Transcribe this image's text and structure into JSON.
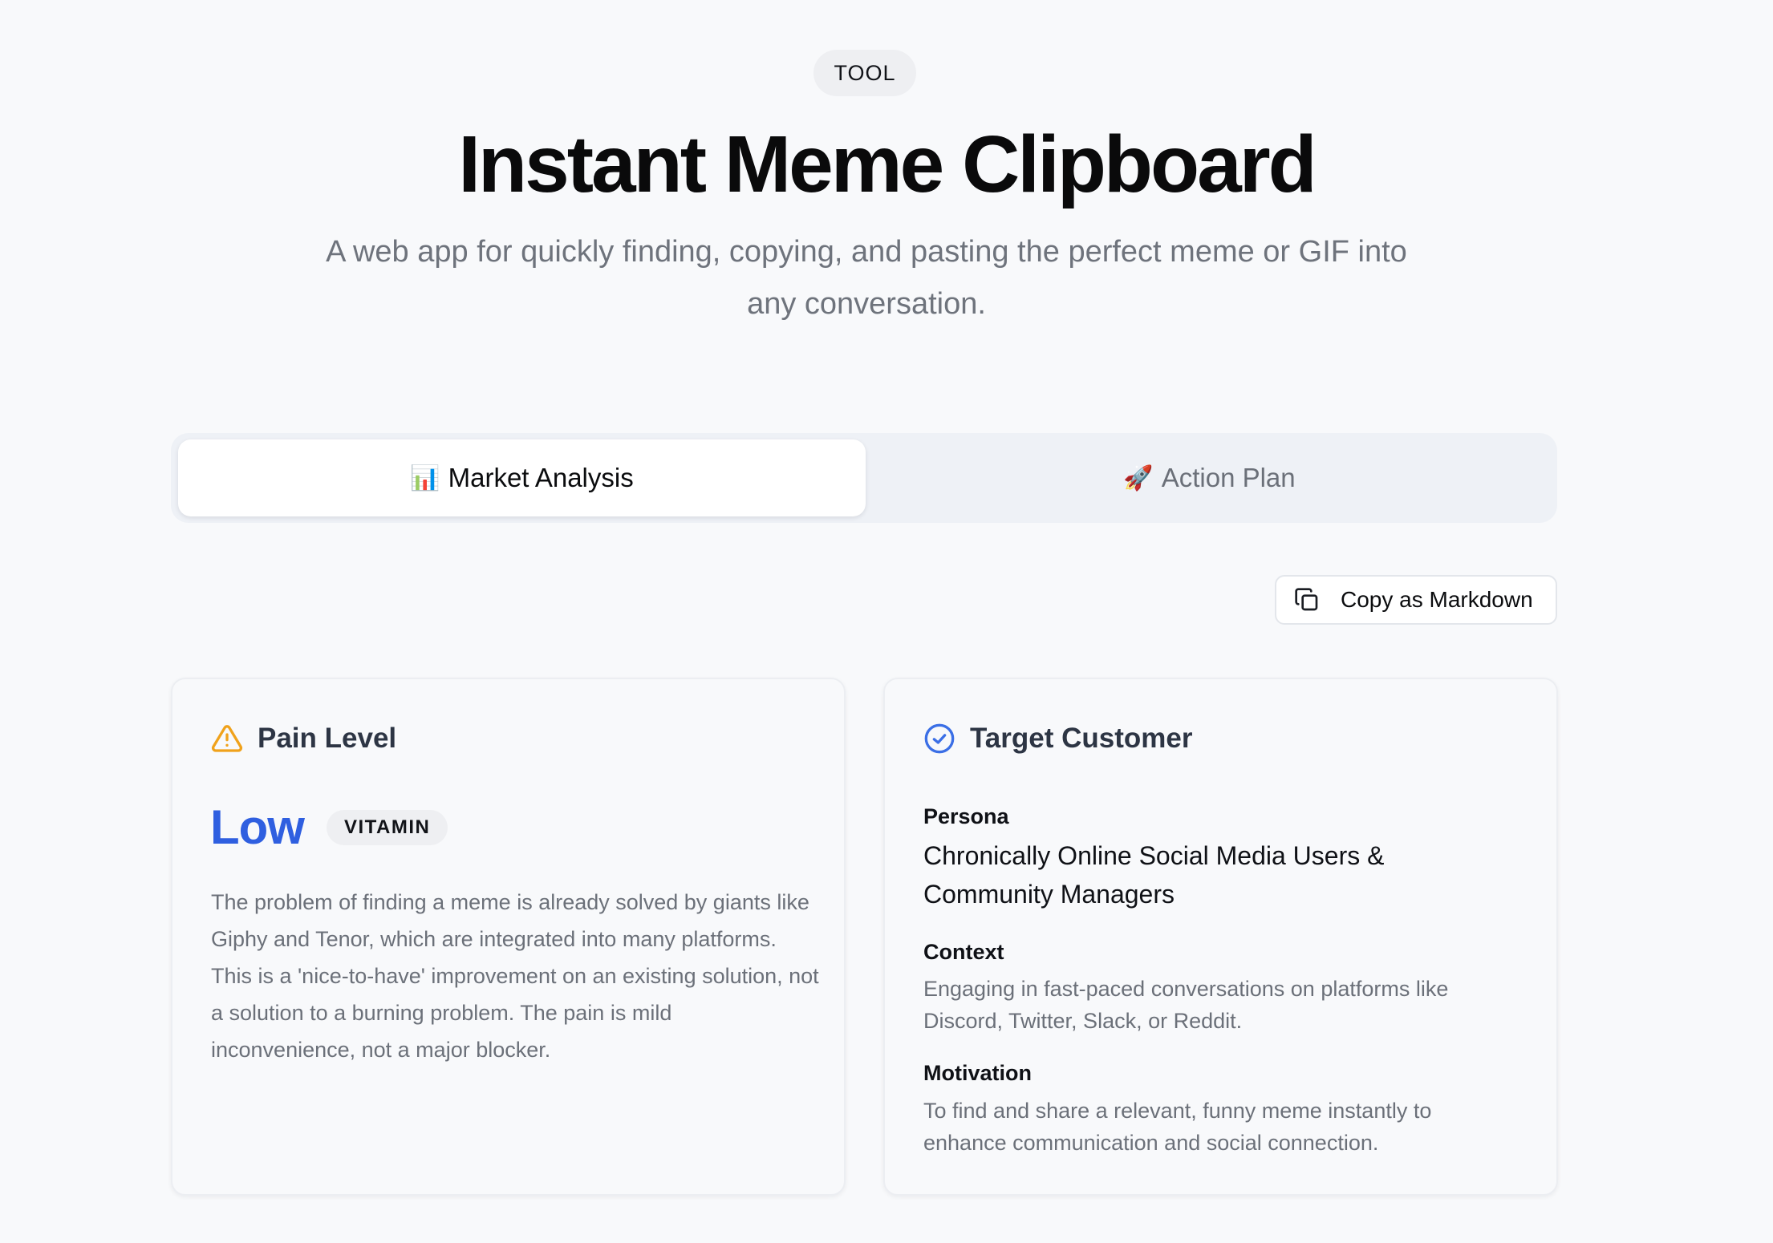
{
  "header": {
    "badge": "TOOL",
    "title": "Instant Meme Clipboard",
    "subtitle": "A web app for quickly finding, copying, and pasting the perfect meme or GIF into any conversation."
  },
  "tabs": [
    {
      "emoji": "📊",
      "label": "Market Analysis",
      "active": true
    },
    {
      "emoji": "🚀",
      "label": "Action Plan",
      "active": false
    }
  ],
  "toolbar": {
    "copy_label": "Copy as Markdown"
  },
  "pain_card": {
    "title": "Pain Level",
    "value": "Low",
    "tag": "VITAMIN",
    "description": "The problem of finding a meme is already solved by giants like Giphy and Tenor, which are integrated into many platforms. This is a 'nice-to-have' improvement on an existing solution, not a solution to a burning problem. The pain is mild inconvenience, not a major blocker."
  },
  "customer_card": {
    "title": "Target Customer",
    "persona_label": "Persona",
    "persona_value": "Chronically Online Social Media Users & Community Managers",
    "context_label": "Context",
    "context_value": "Engaging in fast-paced conversations on platforms like Discord, Twitter, Slack, or Reddit.",
    "motivation_label": "Motivation",
    "motivation_value": "To find and share a relevant, funny meme instantly to enhance communication and social connection."
  },
  "colors": {
    "accent_blue": "#2f5fe0",
    "warning_amber": "#f0a21b",
    "check_blue": "#3b6fe6"
  },
  "icons": {
    "copy": "copy-icon",
    "warning": "warning-triangle-icon",
    "check": "check-circle-icon"
  }
}
